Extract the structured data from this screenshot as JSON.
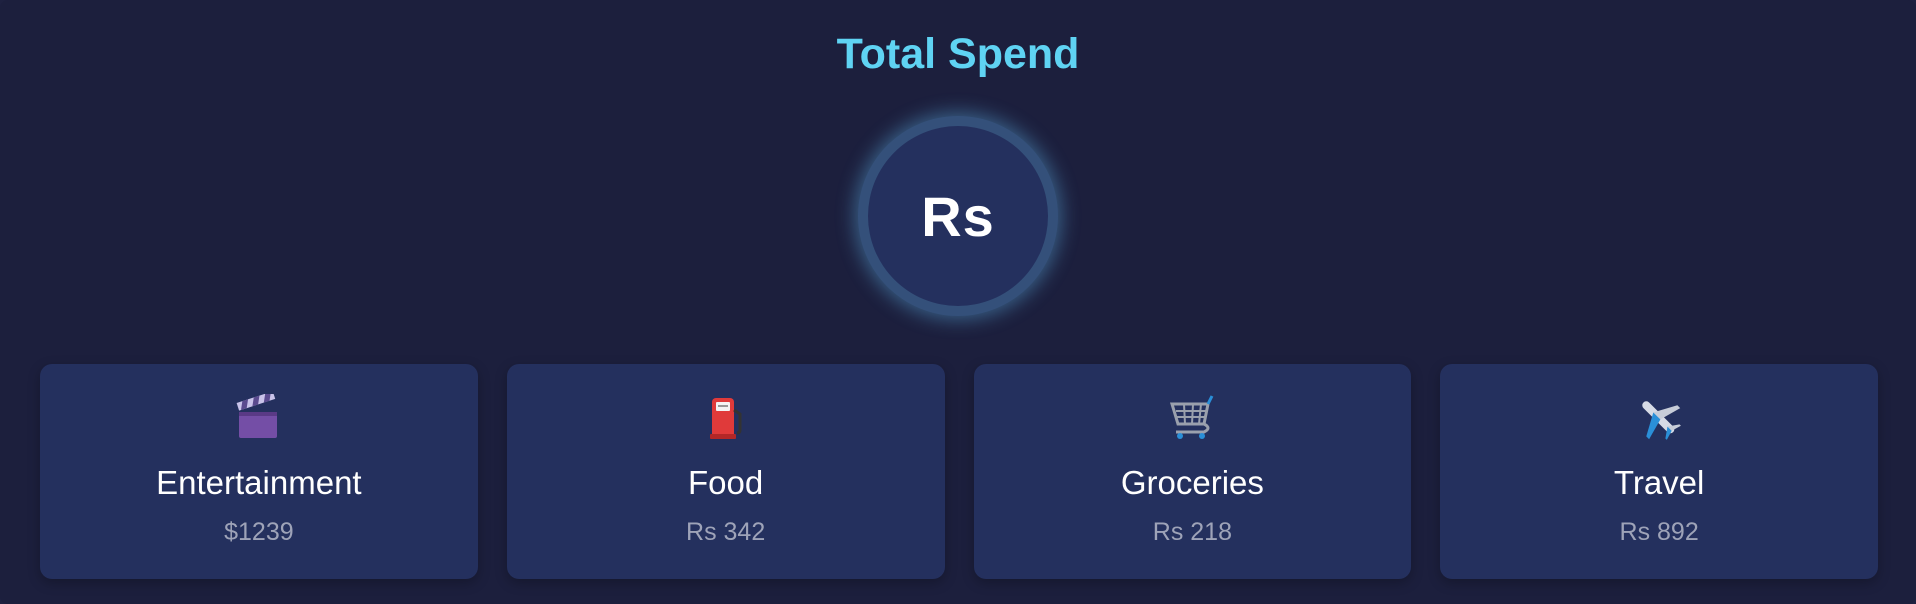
{
  "header": {
    "title": "Total Spend"
  },
  "total": {
    "currency_symbol": "Rs"
  },
  "categories": [
    {
      "label": "Entertainment",
      "value": "$1239",
      "icon": "clapperboard-icon"
    },
    {
      "label": "Food",
      "value": "Rs 342",
      "icon": "fuel-pump-icon"
    },
    {
      "label": "Groceries",
      "value": "Rs 218",
      "icon": "shopping-cart-icon"
    },
    {
      "label": "Travel",
      "value": "Rs 892",
      "icon": "airplane-icon"
    }
  ],
  "colors": {
    "background": "#1c1f3d",
    "card": "#24305e",
    "title": "#5fd3f3",
    "value_text": "#9ea3b8"
  }
}
